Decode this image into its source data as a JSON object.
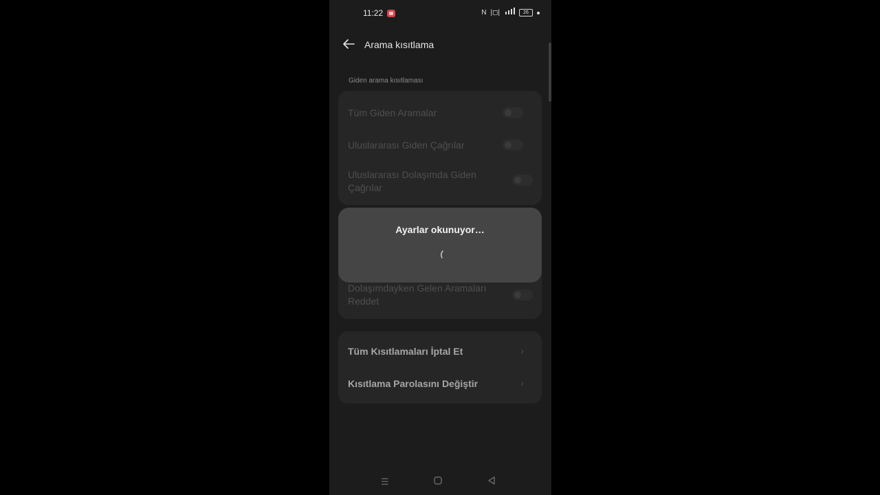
{
  "status_bar": {
    "time": "11:22",
    "icons": [
      "nfc-icon",
      "vibrate-icon",
      "signal-icon",
      "battery-icon"
    ],
    "battery_level": "26"
  },
  "header": {
    "title": "Arama kısıtlama"
  },
  "outgoing_section": {
    "label": "Giden arama kısıtlaması",
    "items": [
      {
        "label": "Tüm Giden Aramalar",
        "enabled": false
      },
      {
        "label": "Uluslararası Giden Çağrılar",
        "enabled": false
      },
      {
        "label": "Uluslararası Dolaşımda Giden Çağrılar",
        "enabled": false
      }
    ]
  },
  "incoming_section": {
    "items": [
      {
        "label": "Dolaşımdayken Gelen Aramaları Reddet",
        "enabled": false
      }
    ]
  },
  "actions": {
    "items": [
      {
        "label": "Tüm Kısıtlamaları İptal Et"
      },
      {
        "label": "Kısıtlama Parolasını Değiştir"
      }
    ]
  },
  "dialog": {
    "title": "Ayarlar okunuyor…"
  },
  "colors": {
    "background": "#1c1c1c",
    "card": "#262626",
    "dialog": "#454545"
  }
}
